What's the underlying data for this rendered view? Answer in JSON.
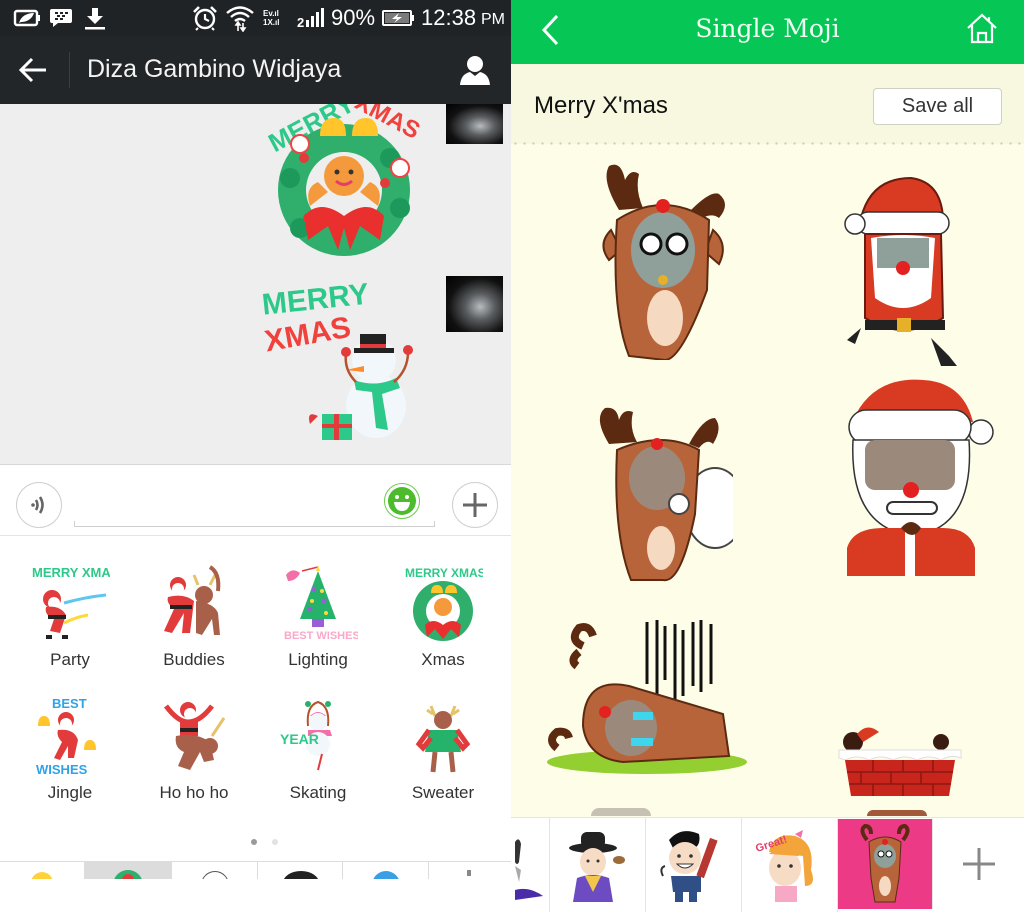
{
  "left_app": {
    "status_bar": {
      "icons_left": [
        "battery-saver-icon",
        "bbm-icon",
        "download-icon"
      ],
      "icons_right": [
        "alarm-icon",
        "wifi-icon",
        "network-ev-1x-icon",
        "signal-icon",
        "battery-charging-icon"
      ],
      "network_label_top": "Ev.ıl",
      "network_label_bottom": "1X.ıl",
      "signal_prefix": "2",
      "battery_percent": "90%",
      "time": "12:38",
      "ampm": "PM"
    },
    "action_bar": {
      "back_icon": "arrow-left-icon",
      "title": "Diza Gambino Widjaya",
      "profile_icon": "person-icon"
    },
    "chat": {
      "messages": [
        {
          "type": "sticker",
          "sender": "self",
          "sticker": "merry-xmas-gingerbread-wreath",
          "text_top": "MERRY XMAS"
        },
        {
          "type": "sticker",
          "sender": "self",
          "sticker": "merry-xmas-snowman",
          "text_line1": "MERRY",
          "text_line2": "XMAS"
        }
      ]
    },
    "input_bar": {
      "voice_icon": "voice-wave-icon",
      "text_value": "",
      "emoji_icon": "smiley-icon",
      "add_icon": "plus-icon"
    },
    "sticker_panel": {
      "stickers": [
        {
          "label": "Party",
          "art_text": "MERRY XMAS"
        },
        {
          "label": "Buddies",
          "art_text": ""
        },
        {
          "label": "Lighting",
          "art_text": "BEST WISHES"
        },
        {
          "label": "Xmas",
          "art_text": "MERRY XMAS"
        },
        {
          "label": "Jingle",
          "art_text": "BEST WISHES"
        },
        {
          "label": "Ho ho ho",
          "art_text": ""
        },
        {
          "label": "Skating",
          "art_text": "YEAR"
        },
        {
          "label": "Sweater",
          "art_text": ""
        }
      ],
      "page_indicator": {
        "current": 1,
        "total": 2
      },
      "tabs": [
        {
          "name": "emoji-tab",
          "active": false
        },
        {
          "name": "xmas-sticker-tab",
          "active": true
        },
        {
          "name": "outline-face-tab",
          "active": false
        },
        {
          "name": "character-tab",
          "active": false
        },
        {
          "name": "doraemon-tab",
          "active": false
        },
        {
          "name": "more-tab",
          "active": false
        }
      ]
    }
  },
  "right_app": {
    "header": {
      "back_icon": "chevron-left-icon",
      "title": "Single Moji",
      "home_icon": "home-icon"
    },
    "section": {
      "title": "Merry X'mas",
      "save_all_label": "Save all"
    },
    "mojis": [
      {
        "name": "reindeer-shy"
      },
      {
        "name": "santa-running"
      },
      {
        "name": "reindeer-with-sack"
      },
      {
        "name": "santa-smiling"
      },
      {
        "name": "reindeer-fallen"
      },
      {
        "name": "santa-in-chimney"
      }
    ],
    "tab_bar": {
      "tabs": [
        {
          "name": "partial-character-tab",
          "active": false
        },
        {
          "name": "korean-scholar-tab",
          "active": false
        },
        {
          "name": "chainsaw-guy-tab",
          "active": false
        },
        {
          "name": "great-girl-tab",
          "active": false,
          "art_text": "Great!"
        },
        {
          "name": "reindeer-tab",
          "active": true
        }
      ],
      "add_icon": "plus-icon"
    },
    "colors": {
      "header_green": "#06c755",
      "active_tab_pink": "#ec3a86",
      "background_cream": "#fefde8"
    }
  },
  "colors": {
    "left_status_bar": "#202326",
    "left_action_bar": "#232629",
    "chat_bg": "#eeeeee",
    "emoji_green": "#4dbb2b"
  }
}
